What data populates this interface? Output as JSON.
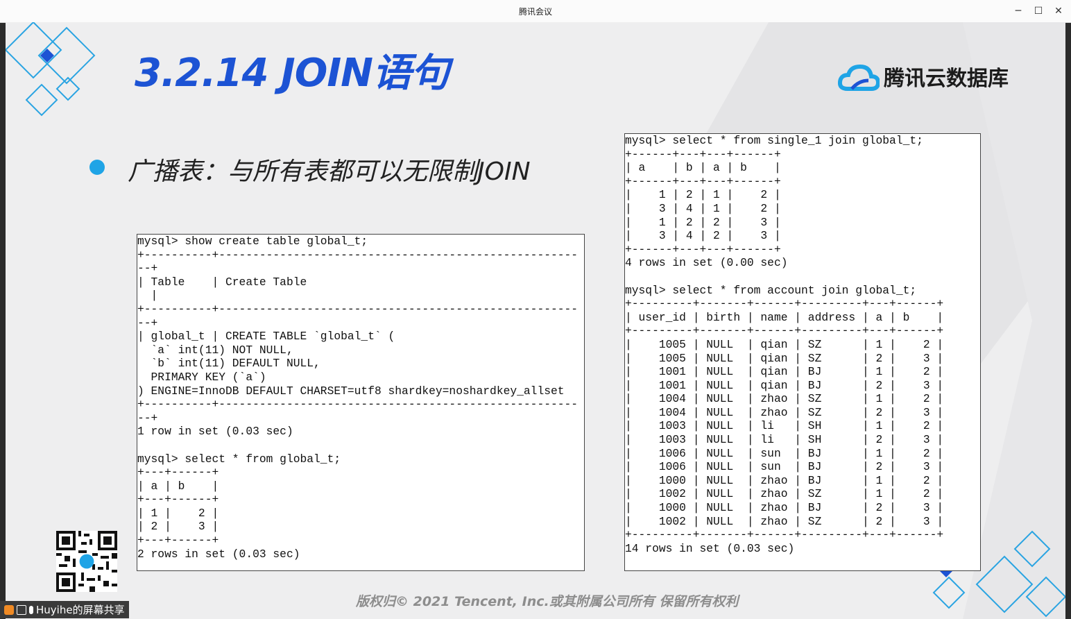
{
  "window": {
    "title": "腾讯会议",
    "controls": {
      "minimize": "─",
      "maximize": "☐",
      "close": "✕"
    }
  },
  "slide": {
    "title": "3.2.14 JOIN语句",
    "brand": "腾讯云数据库",
    "bullet": "广播表：与所有表都可以无限制JOIN",
    "copyright": "版权归© 2021 Tencent, Inc.或其附属公司所有 保留所有权利",
    "accent_color": "#1c53d4",
    "bullet_color": "#1fa4e6"
  },
  "terminal_left": {
    "lines": [
      "mysql> show create table global_t;",
      "+----------+-----------------------------------------------------",
      "--+",
      "| Table    | Create Table",
      "  |",
      "+----------+-----------------------------------------------------",
      "--+",
      "| global_t | CREATE TABLE `global_t` (",
      "  `a` int(11) NOT NULL,",
      "  `b` int(11) DEFAULT NULL,",
      "  PRIMARY KEY (`a`)",
      ") ENGINE=InnoDB DEFAULT CHARSET=utf8 shardkey=noshardkey_allset",
      "+----------+-----------------------------------------------------",
      "--+",
      "1 row in set (0.03 sec)",
      "",
      "mysql> select * from global_t;",
      "+---+------+",
      "| a | b    |",
      "+---+------+",
      "| 1 |    2 |",
      "| 2 |    3 |",
      "+---+------+",
      "2 rows in set (0.03 sec)"
    ]
  },
  "terminal_right": {
    "lines": [
      "mysql> select * from single_1 join global_t;",
      "+------+---+---+------+",
      "| a    | b | a | b    |",
      "+------+---+---+------+",
      "|    1 | 2 | 1 |    2 |",
      "|    3 | 4 | 1 |    2 |",
      "|    1 | 2 | 2 |    3 |",
      "|    3 | 4 | 2 |    3 |",
      "+------+---+---+------+",
      "4 rows in set (0.00 sec)",
      "",
      "mysql> select * from account join global_t;",
      "+---------+-------+------+---------+---+------+",
      "| user_id | birth | name | address | a | b    |",
      "+---------+-------+------+---------+---+------+",
      "|    1005 | NULL  | qian | SZ      | 1 |    2 |",
      "|    1005 | NULL  | qian | SZ      | 2 |    3 |",
      "|    1001 | NULL  | qian | BJ      | 1 |    2 |",
      "|    1001 | NULL  | qian | BJ      | 2 |    3 |",
      "|    1004 | NULL  | zhao | SZ      | 1 |    2 |",
      "|    1004 | NULL  | zhao | SZ      | 2 |    3 |",
      "|    1003 | NULL  | li   | SH      | 1 |    2 |",
      "|    1003 | NULL  | li   | SH      | 2 |    3 |",
      "|    1006 | NULL  | sun  | BJ      | 1 |    2 |",
      "|    1006 | NULL  | sun  | BJ      | 2 |    3 |",
      "|    1000 | NULL  | zhao | BJ      | 1 |    2 |",
      "|    1002 | NULL  | zhao | SZ      | 1 |    2 |",
      "|    1000 | NULL  | zhao | BJ      | 2 |    3 |",
      "|    1002 | NULL  | zhao | SZ      | 2 |    3 |",
      "+---------+-------+------+---------+---+------+",
      "14 rows in set (0.03 sec)"
    ]
  },
  "share_bar": {
    "label": "Huyihe的屏幕共享"
  }
}
